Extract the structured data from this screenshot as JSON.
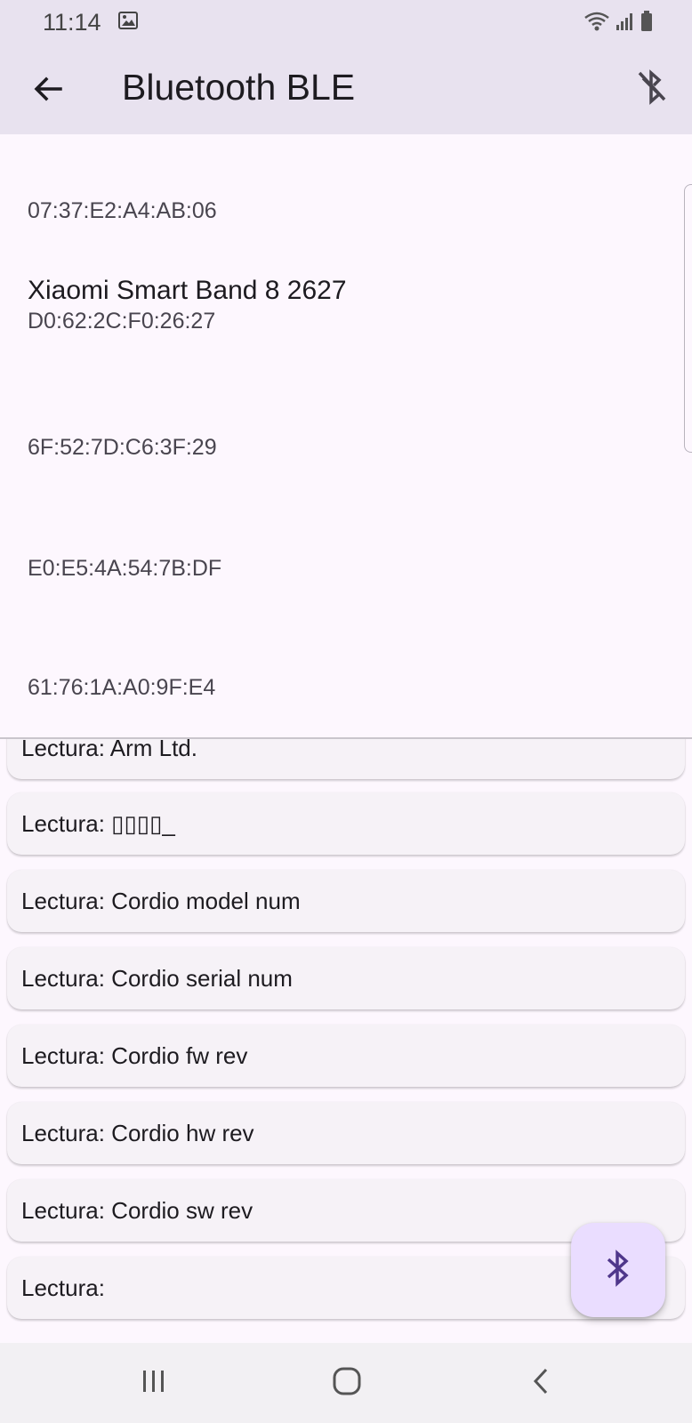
{
  "status_bar": {
    "time": "11:14"
  },
  "app_bar": {
    "title": "Bluetooth BLE"
  },
  "devices": [
    {
      "name": "",
      "mac": "07:37:E2:A4:AB:06"
    },
    {
      "name": "Xiaomi Smart Band 8 2627",
      "mac": "D0:62:2C:F0:26:27"
    },
    {
      "name": "",
      "mac": "6F:52:7D:C6:3F:29"
    },
    {
      "name": "",
      "mac": "E0:E5:4A:54:7B:DF"
    },
    {
      "name": "",
      "mac": "61:76:1A:A0:9F:E4"
    }
  ],
  "readings": [
    "Lectura: Arm Ltd.",
    "Lectura: ▯▯▯▯_",
    "Lectura: Cordio model num",
    "Lectura: Cordio serial num",
    "Lectura: Cordio fw rev",
    "Lectura: Cordio hw rev",
    "Lectura: Cordio sw rev",
    "Lectura: "
  ],
  "icons": {
    "back": "arrow-back-icon",
    "bluetooth_disabled": "bluetooth-disabled-icon",
    "fab": "bluetooth-icon"
  },
  "colors": {
    "fab_bg": "#eaddff",
    "fab_icon": "#4f378b",
    "appbar_bg": "#e8e2ef"
  }
}
